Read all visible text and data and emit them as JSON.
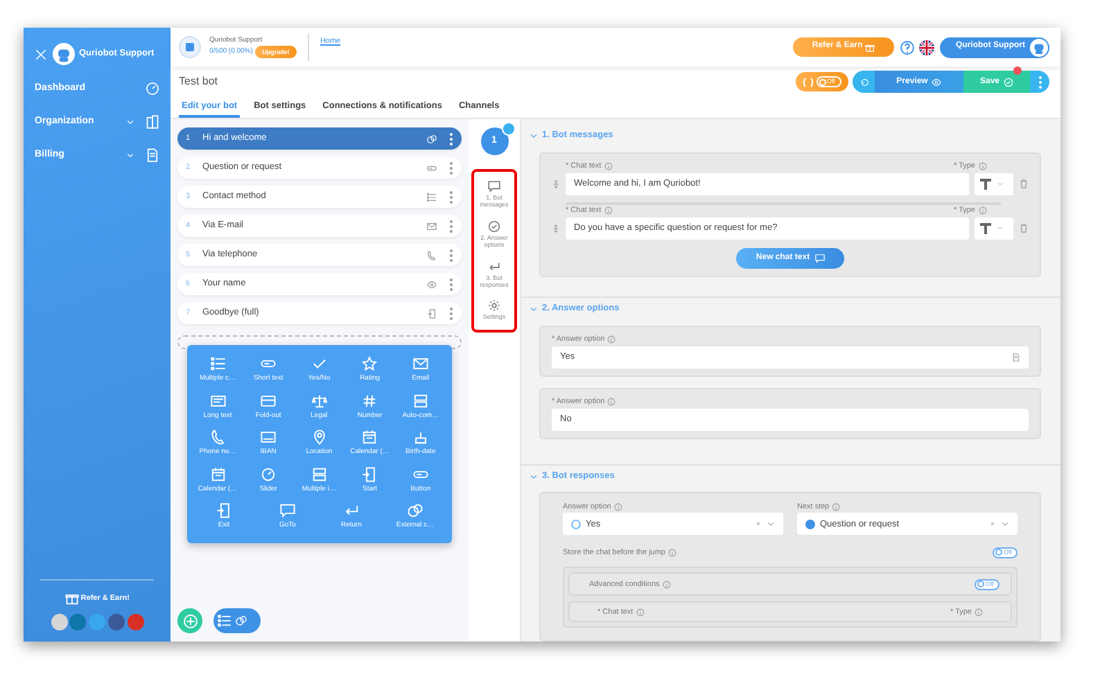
{
  "sidebar": {
    "title": "Quriobot Support",
    "items": [
      {
        "label": "Dashboard",
        "expandable": false
      },
      {
        "label": "Organization",
        "expandable": true
      },
      {
        "label": "Billing",
        "expandable": true
      }
    ],
    "refer": "Refer & Earn!",
    "socials": [
      {
        "color": "#d6d6d6"
      },
      {
        "color": "#0e76a8"
      },
      {
        "color": "#3aa7ec"
      },
      {
        "color": "#3b5998"
      },
      {
        "color": "#d93025"
      }
    ]
  },
  "header": {
    "account": "Quriobot Support",
    "usage": "0/500 (0.00%)",
    "upgrade": "Upgrade!",
    "home": "Home",
    "refer": "Refer & Earn",
    "user": "Quriobot Support"
  },
  "toolbar": {
    "title": "Test bot",
    "toggle": {
      "label": "Off",
      "on": false
    },
    "preview": "Preview",
    "save": "Save",
    "unsaved": true
  },
  "tabs": [
    {
      "label": "Edit your bot",
      "selected": true
    },
    {
      "label": "Bot settings",
      "selected": false
    },
    {
      "label": "Connections & notifications",
      "selected": false
    },
    {
      "label": "Channels",
      "selected": false
    }
  ],
  "steps": [
    {
      "number": "1",
      "label": "Hi and welcome",
      "selected": true
    },
    {
      "number": "2",
      "label": "Question or request",
      "selected": false
    },
    {
      "number": "3",
      "label": "Contact method",
      "selected": false
    },
    {
      "number": "4",
      "label": "Via E-mail",
      "selected": false
    },
    {
      "number": "5",
      "label": "Via telephone",
      "selected": false
    },
    {
      "number": "6",
      "label": "Your name",
      "selected": false
    },
    {
      "number": "7",
      "label": "Goodbye (full)",
      "selected": false
    }
  ],
  "palette": [
    "Multiple c…",
    "Short text",
    "Yes/No",
    "Rating",
    "Email",
    "Long text",
    "Fold-out",
    "Legal",
    "Number",
    "Auto-com…",
    "Phone nu…",
    "IBAN",
    "Location",
    "Calendar (…",
    "Birth-date",
    "Calendar (…",
    "Slider",
    "Multiple i…",
    "Start",
    "Button",
    "Exit",
    "GoTo",
    "Return",
    "External c…"
  ],
  "step_badge": "1",
  "step_nav": [
    "1. Bot messages",
    "2. Answer options",
    "3. Bot responses",
    "Settings"
  ],
  "bot_messages": {
    "title": "1. Bot messages",
    "expanded": true,
    "chat_texts": [
      {
        "label": "* Chat text",
        "value": "Welcome and hi, I am Quriobot!",
        "type_label": "* Type"
      },
      {
        "label": "* Chat text",
        "value": "Do you have a specific question or request for me?",
        "type_label": "* Type"
      }
    ],
    "add_button": "New chat text"
  },
  "answer_options": {
    "title": "2. Answer options",
    "expanded": true,
    "options": [
      {
        "label": "* Answer option",
        "value": "Yes"
      },
      {
        "label": "* Answer option",
        "value": "No"
      }
    ]
  },
  "bot_responses": {
    "title": "3. Bot responses",
    "expanded": true,
    "answer_label": "Answer option",
    "answer_value": "Yes",
    "next_label": "Next step",
    "next_value": "Question or request",
    "store_label": "Store the chat before the jump",
    "store_toggle": {
      "label": "Off",
      "on": false
    },
    "advanced_label": "Advanced conditions",
    "advanced_toggle": {
      "label": "Off",
      "on": false
    },
    "chat_label": "* Chat text",
    "type_label": "* Type"
  }
}
